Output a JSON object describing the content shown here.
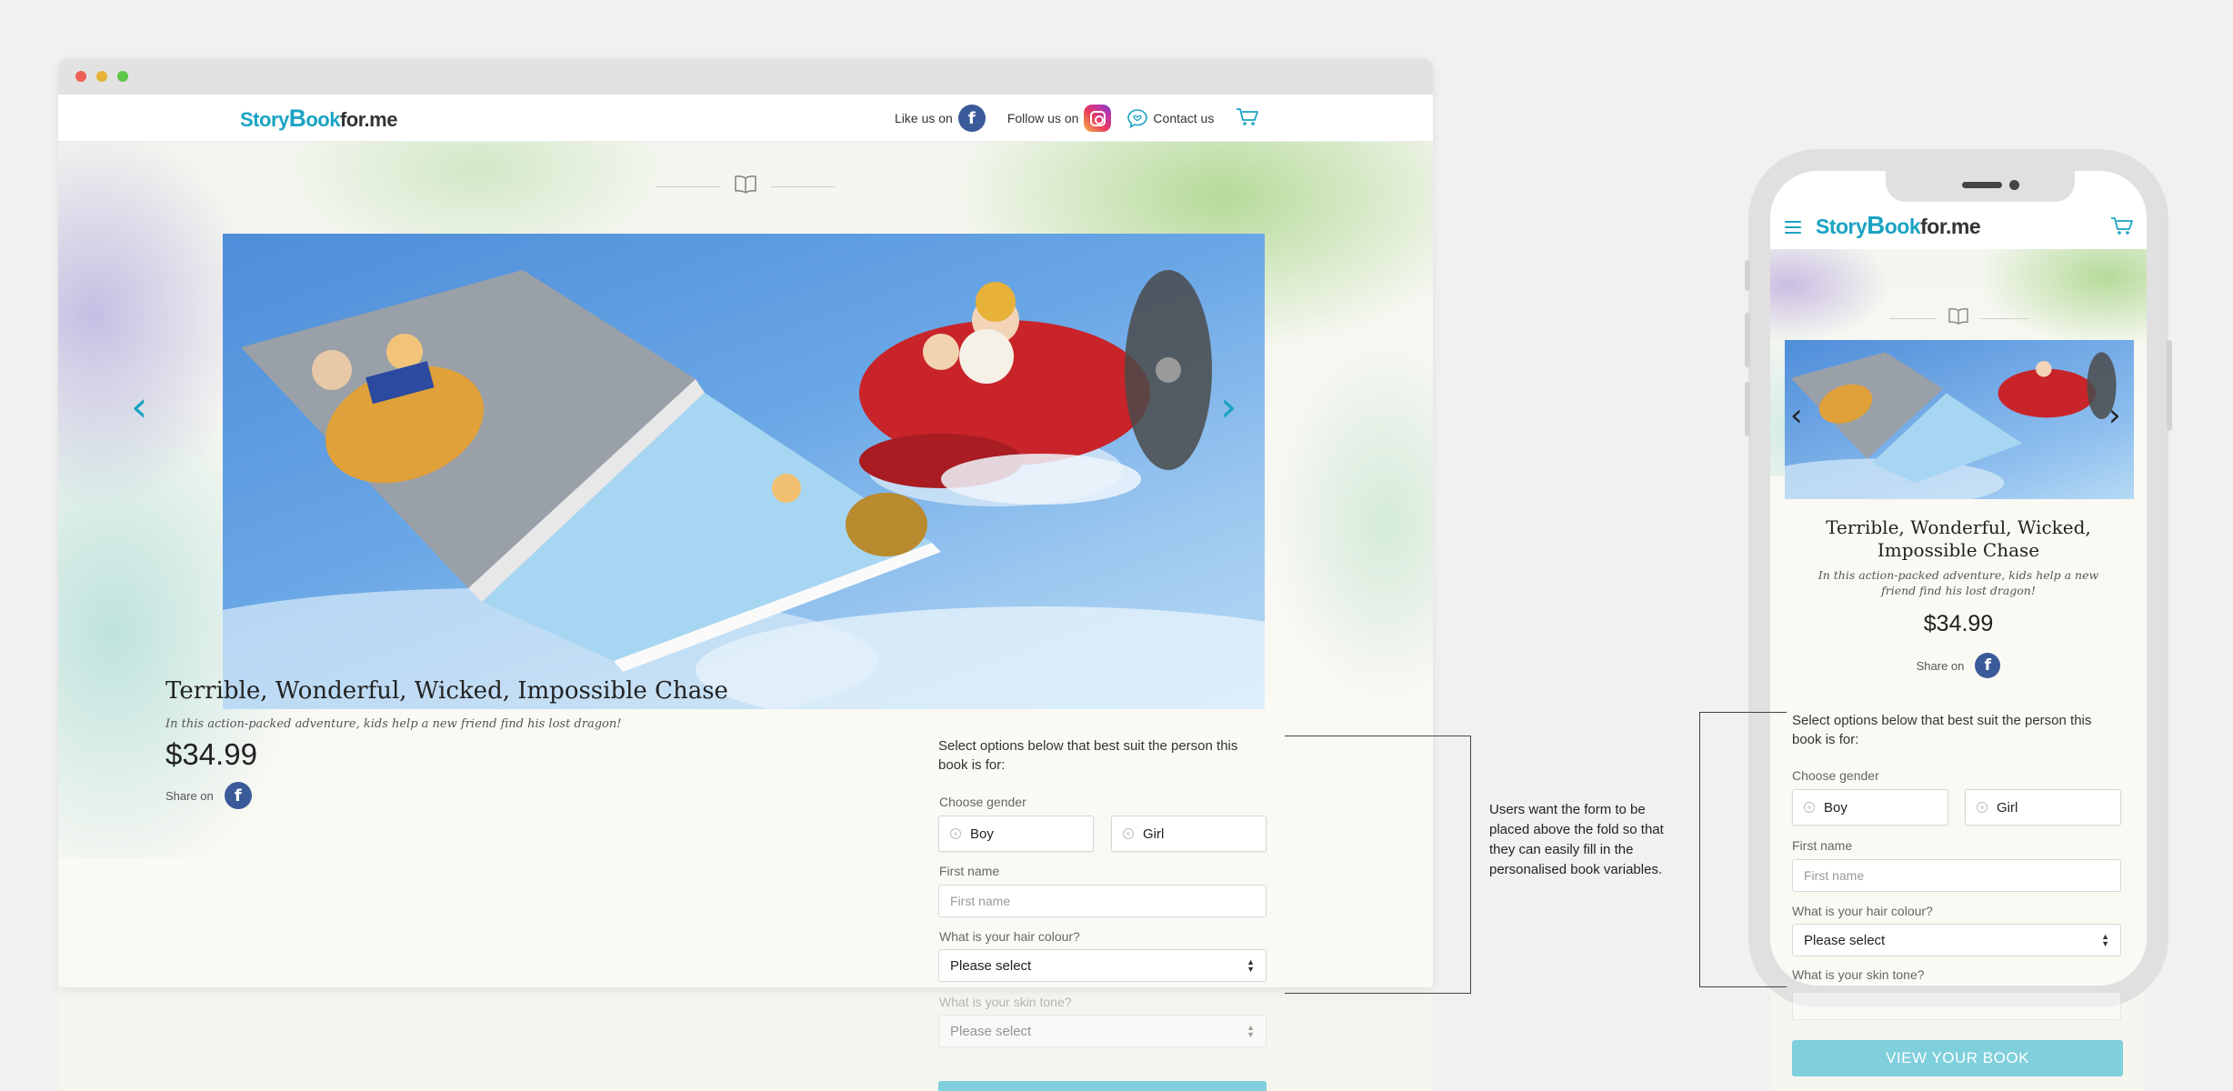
{
  "desktop": {
    "logo": {
      "story": "Story",
      "b": "B",
      "rest": "ook",
      "suffix": "for.me"
    },
    "header": {
      "like_label": "Like us on",
      "follow_label": "Follow us on",
      "contact_label": "Contact us",
      "facebook_glyph": "f"
    },
    "product": {
      "title": "Terrible, Wonderful, Wicked, Impossible Chase",
      "description": "In this action-packed adventure, kids help a new friend find his lost dragon!",
      "price": "$34.99",
      "share_label": "Share on",
      "facebook_glyph": "f"
    },
    "carousel": {
      "prev_glyph": "‹",
      "next_glyph": "›"
    },
    "form": {
      "intro": "Select options below that best suit the person this book is for:",
      "gender_label": "Choose gender",
      "gender_options": [
        "Boy",
        "Girl"
      ],
      "first_name_label": "First name",
      "first_name_placeholder": "First name",
      "hair_label": "What is your hair colour?",
      "hair_value": "Please select",
      "skin_label": "What is your skin tone?",
      "skin_value": "Please select"
    }
  },
  "annotation": {
    "text_lines": [
      "Users want the form to be",
      "placed above the fold so that",
      "they can easily fill in the",
      "personalised book variables."
    ]
  },
  "mobile": {
    "logo": {
      "story": "Story",
      "b": "B",
      "rest": "ook",
      "suffix": "for.me"
    },
    "product": {
      "title": "Terrible, Wonderful, Wicked, Impossible Chase",
      "description": "In this action-packed adventure, kids help a new friend find his lost dragon!",
      "price": "$34.99",
      "share_label": "Share on",
      "facebook_glyph": "f"
    },
    "carousel": {
      "prev_glyph": "‹",
      "next_glyph": "›"
    },
    "form": {
      "intro": "Select options below that best suit the person this book is for:",
      "gender_label": "Choose gender",
      "gender_options": [
        "Boy",
        "Girl"
      ],
      "first_name_label": "First name",
      "first_name_placeholder": "First name",
      "hair_label": "What is your hair colour?",
      "hair_value": "Please select",
      "skin_label": "What is your skin tone?",
      "cta_label": "VIEW YOUR BOOK"
    }
  },
  "colors": {
    "brand": "#1aa3c2",
    "facebook": "#3b5a9a",
    "cta": "#7fcfdc",
    "background": "#f1f1f1",
    "page": "#fbf9f4"
  },
  "icons": [
    "book-icon",
    "facebook-icon",
    "instagram-icon",
    "chat-icon",
    "cart-icon",
    "menu-icon",
    "chevron-left-icon",
    "chevron-right-icon",
    "select-arrows-icon",
    "radio-icon"
  ]
}
